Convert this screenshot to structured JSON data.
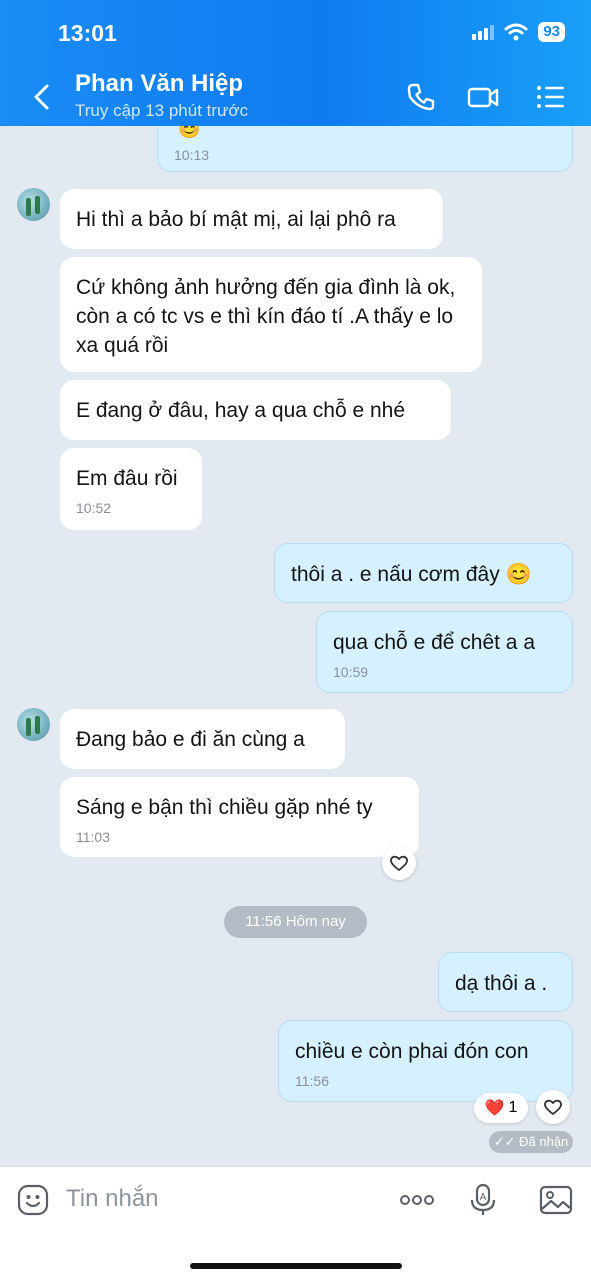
{
  "status_bar": {
    "time": "13:01",
    "battery": "93"
  },
  "header": {
    "title": "Phan Văn Hiệp",
    "subtitle": "Truy cập 13 phút trước"
  },
  "messages": [
    {
      "text": "😊",
      "time": "10:13"
    },
    {
      "text": "Hi thì a bảo bí mật mị, ai lại phô ra"
    },
    {
      "text": "Cứ không ảnh hưởng đến gia đình  là ok, còn a có tc vs e thì kín đáo tí  .A thấy e lo xa quá rồi"
    },
    {
      "text": "E đang ở đâu, hay a qua chỗ e nhé"
    },
    {
      "text": "Em đâu rồi",
      "time": "10:52"
    },
    {
      "text": "thôi a . e nấu cơm đây 😊"
    },
    {
      "text": "qua chỗ e để chêt a a",
      "time": "10:59"
    },
    {
      "text": "Đang bảo e đi ăn cùng a"
    },
    {
      "text": "Sáng e bận thì chiều gặp nhé ty",
      "time": "11:03"
    },
    {
      "text": "dạ thôi a ."
    },
    {
      "text": "chiều e còn phai đón con",
      "time": "11:56"
    }
  ],
  "date_separator": "11:56 Hôm nay",
  "reaction": {
    "emoji": "❤️",
    "count": "1"
  },
  "delivery_status": "Đã nhận",
  "composer": {
    "placeholder": "Tin nhắn"
  },
  "icons": [
    "back-icon",
    "phone-icon",
    "video-call-icon",
    "menu-icon",
    "heart-icon",
    "sticker-icon",
    "more-icon",
    "voice-icon",
    "image-icon"
  ],
  "colors": {
    "header": "#1a8cf5",
    "outgoing_bubble": "#d5f0ff",
    "incoming_bubble": "#ffffff",
    "background": "#e2e9f1"
  }
}
